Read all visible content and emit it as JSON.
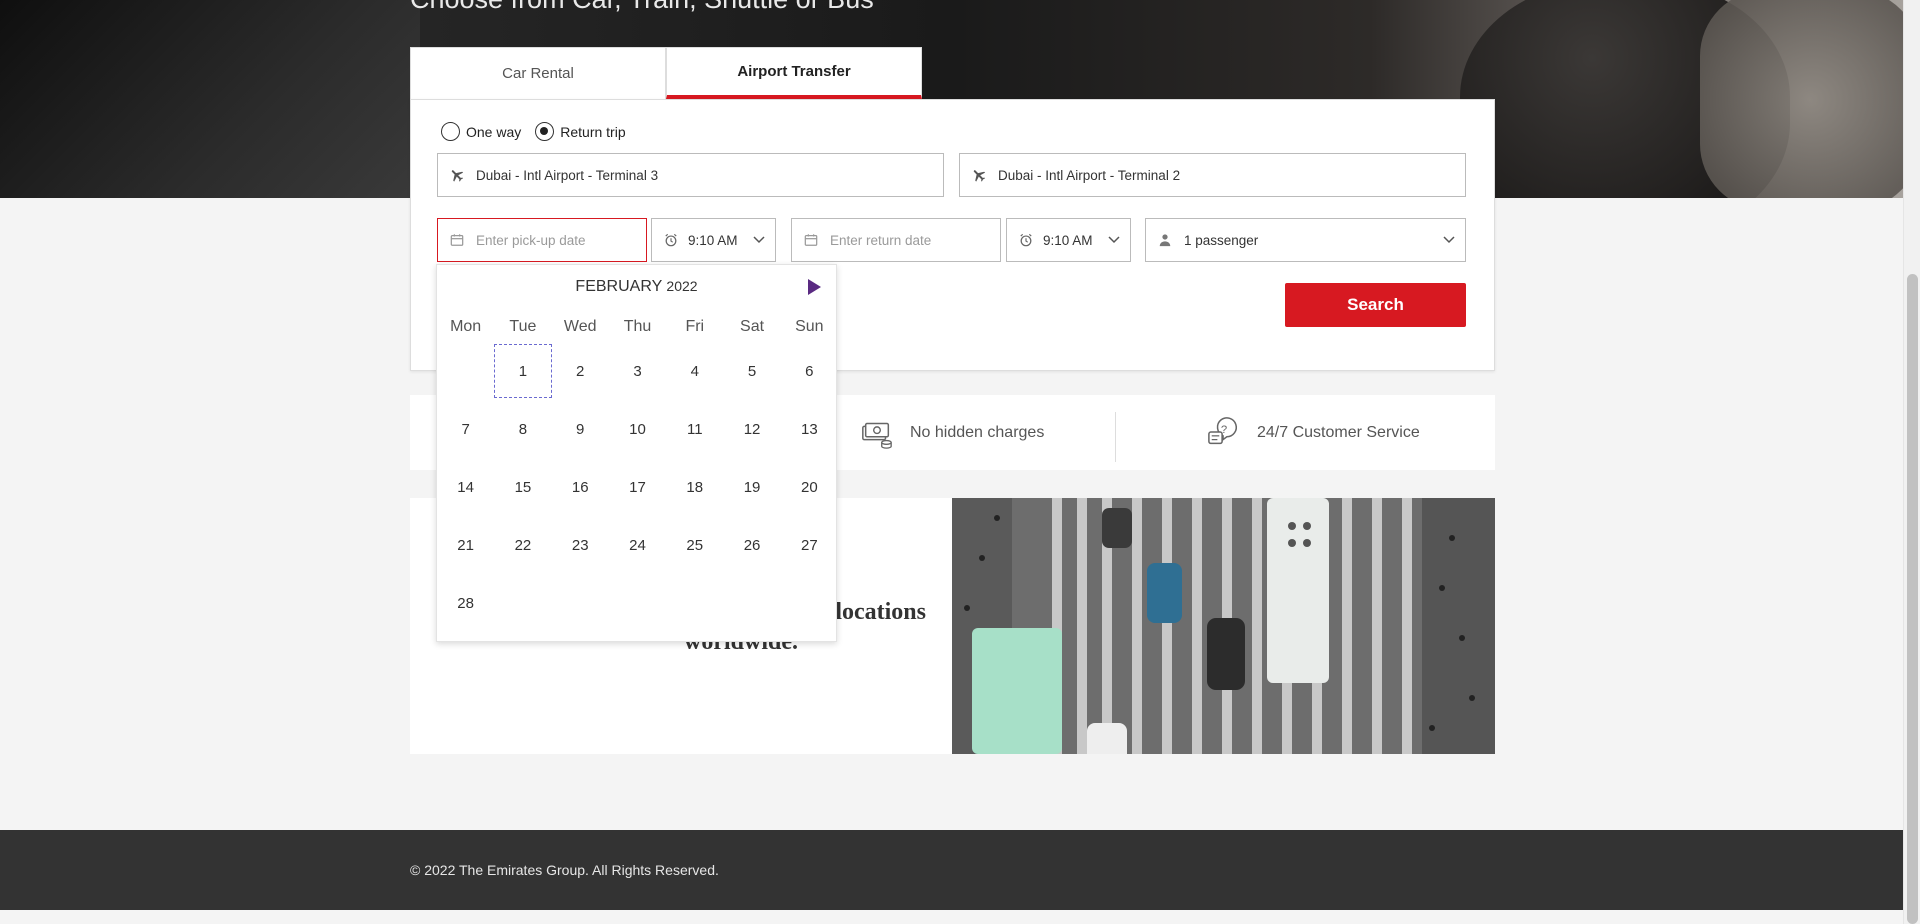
{
  "hero": {
    "title": "Choose from Car, Train, Shuttle or Bus"
  },
  "tabs": [
    {
      "label": "Car Rental",
      "active": false
    },
    {
      "label": "Airport Transfer",
      "active": true
    }
  ],
  "trip_type": {
    "one_way_label": "One way",
    "return_trip_label": "Return trip",
    "selected": "Return trip"
  },
  "from_location": {
    "value": "Dubai - Intl Airport - Terminal 3",
    "icon": "plane-icon"
  },
  "to_location": {
    "value": "Dubai - Intl Airport - Terminal 2",
    "icon": "plane-icon"
  },
  "pickup_date": {
    "placeholder": "Enter pick-up date",
    "icon": "calendar-icon"
  },
  "pickup_time": {
    "value": "9:10 AM",
    "icon": "alarm-clock-icon"
  },
  "return_date": {
    "placeholder": "Enter return date",
    "icon": "calendar-icon"
  },
  "return_time": {
    "value": "9:10 AM",
    "icon": "alarm-clock-icon"
  },
  "passengers": {
    "value": "1 passenger",
    "icon": "person-icon"
  },
  "search_label": "Search",
  "calendar": {
    "month": "FEBRUARY",
    "year": "2022",
    "weekdays": [
      "Mon",
      "Tue",
      "Wed",
      "Thu",
      "Fri",
      "Sat",
      "Sun"
    ],
    "weeks": [
      [
        "",
        "1",
        "2",
        "3",
        "4",
        "5",
        "6"
      ],
      [
        "7",
        "8",
        "9",
        "10",
        "11",
        "12",
        "13"
      ],
      [
        "14",
        "15",
        "16",
        "17",
        "18",
        "19",
        "20"
      ],
      [
        "21",
        "22",
        "23",
        "24",
        "25",
        "26",
        "27"
      ],
      [
        "28",
        "",
        "",
        "",
        "",
        "",
        ""
      ]
    ],
    "highlighted_day": "1"
  },
  "features": [
    {
      "label": "No hidden charges",
      "icon": "money-icon"
    },
    {
      "label": "24/7 Customer Service",
      "icon": "customer-service-icon"
    }
  ],
  "promo": {
    "text_line1": "locations",
    "text_line2": "worldwide."
  },
  "footer": {
    "copyright": "© 2022 The Emirates Group. All Rights Reserved."
  },
  "colors": {
    "brand_red": "#d71921",
    "footer_bg": "#333333",
    "calendar_arrow": "#5a2a82"
  }
}
